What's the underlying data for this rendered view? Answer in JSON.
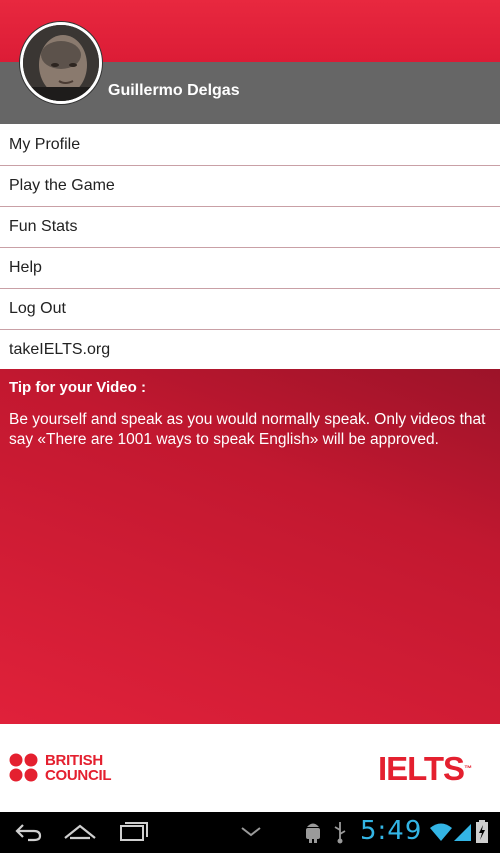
{
  "header": {
    "username": "Guillermo Delgas"
  },
  "menu": {
    "items": [
      {
        "label": "My Profile"
      },
      {
        "label": "Play the Game"
      },
      {
        "label": "Fun Stats"
      },
      {
        "label": "Help"
      },
      {
        "label": "Log Out"
      },
      {
        "label": "takeIELTS.org"
      }
    ]
  },
  "tip": {
    "title": "Tip for your Video :",
    "text": "Be yourself and speak as you would normally speak. Only videos that say «There are 1001 ways to speak English» will be approved."
  },
  "footer": {
    "british_council_line1": "BRITISH",
    "british_council_line2": "COUNCIL",
    "ielts": "IELTS",
    "ielts_tm": "™"
  },
  "system_bar": {
    "time": "5:49",
    "icons": [
      "back-icon",
      "home-icon",
      "recent-apps-icon",
      "keyboard-hide-icon",
      "android-debug-icon",
      "usb-icon",
      "wifi-icon",
      "signal-icon",
      "battery-icon"
    ]
  },
  "colors": {
    "brand_red": "#e4202f",
    "header_grey": "#666666",
    "clock_blue": "#33b5e5"
  }
}
